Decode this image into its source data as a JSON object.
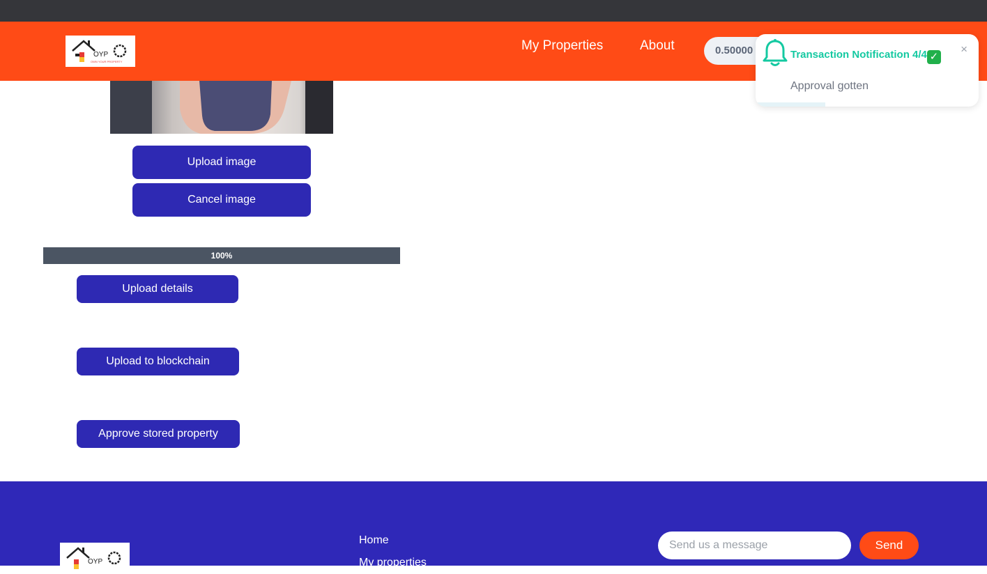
{
  "header": {
    "logo_text": "OYP",
    "logo_tagline": "OWN YOUR PROPERTY",
    "nav": [
      {
        "label": "My Properties"
      },
      {
        "label": "About"
      }
    ],
    "wallet_balance": "0.50000"
  },
  "notification": {
    "title": "Transaction Notification 4/4",
    "message": "Approval gotten",
    "close_symbol": "×",
    "accent_color": "#14c9a1"
  },
  "main": {
    "upload_image_label": "Upload image",
    "cancel_image_label": "Cancel image",
    "progress_text": "100%",
    "progress_value": 100,
    "upload_details_label": "Upload details",
    "upload_blockchain_label": "Upload to blockchain",
    "approve_label": "Approve stored property"
  },
  "footer": {
    "links": [
      {
        "label": "Home"
      },
      {
        "label": "My properties"
      }
    ],
    "message_placeholder": "Send us a message",
    "send_label": "Send"
  },
  "colors": {
    "brand_orange": "#ff4b16",
    "primary_button": "#2e29b3",
    "footer_bg": "#2f28b8"
  }
}
